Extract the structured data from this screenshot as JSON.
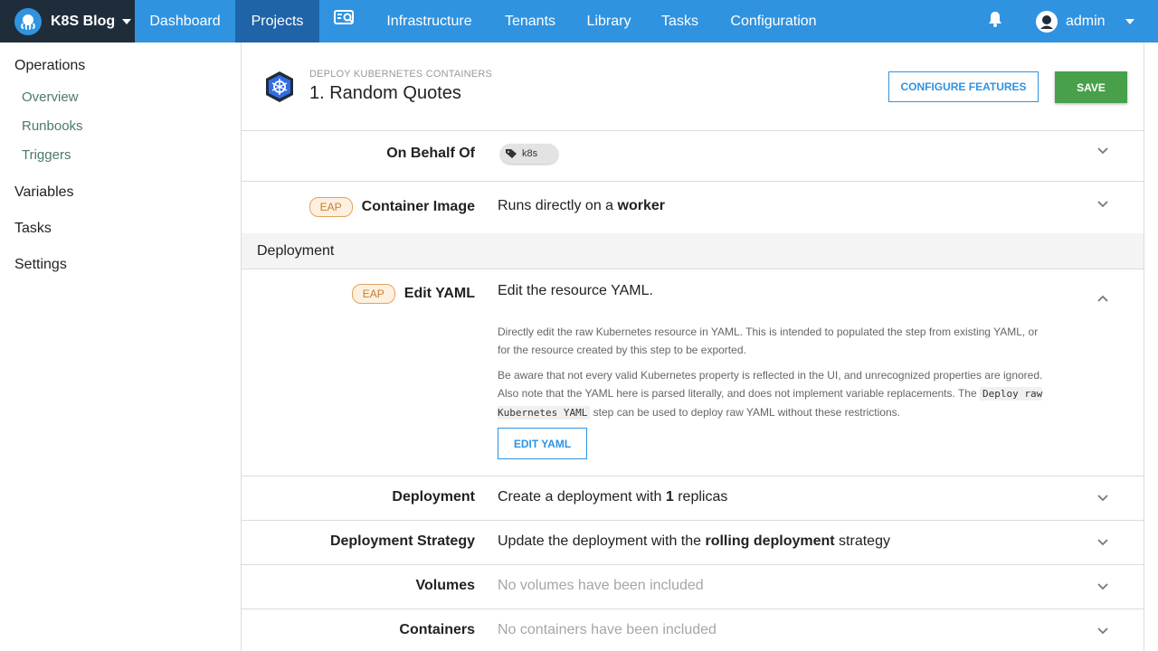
{
  "topbar": {
    "brand": "K8S Blog",
    "nav": [
      {
        "label": "Dashboard"
      },
      {
        "label": "Projects"
      },
      {
        "label": "Infrastructure"
      },
      {
        "label": "Tenants"
      },
      {
        "label": "Library"
      },
      {
        "label": "Tasks"
      },
      {
        "label": "Configuration"
      }
    ],
    "user": "admin",
    "active_nav": "Projects"
  },
  "sidebar": {
    "operations": "Operations",
    "operations_items": [
      "Overview",
      "Runbooks",
      "Triggers"
    ],
    "variables": "Variables",
    "tasks": "Tasks",
    "settings": "Settings"
  },
  "header": {
    "subtitle": "DEPLOY KUBERNETES CONTAINERS",
    "title": "1.  Random Quotes",
    "configure_label": "CONFIGURE FEATURES",
    "save_label": "SAVE"
  },
  "rows": {
    "on_behalf_of": {
      "label": "On Behalf Of",
      "tag": "k8s"
    },
    "container_image": {
      "badge": "EAP",
      "label": "Container Image",
      "value_prefix": "Runs directly on a ",
      "value_bold": "worker"
    },
    "section": "Deployment",
    "edit_yaml": {
      "badge": "EAP",
      "label": "Edit YAML",
      "value": "Edit the resource YAML.",
      "help1": "Directly edit the raw Kubernetes resource in YAML. This is intended to populated the step from existing YAML, or for the resource created by this step to be exported.",
      "help2_a": "Be aware that not every valid Kubernetes property is reflected in the UI, and unrecognized properties are ignored. Also note that the YAML here is parsed literally, and does not implement variable replacements. The ",
      "help2_code": "Deploy raw Kubernetes YAML",
      "help2_b": " step can be used to deploy raw YAML without these restrictions.",
      "button": "EDIT YAML"
    },
    "deployment": {
      "label": "Deployment",
      "pre": "Create a deployment with ",
      "bold": "1",
      "post": " replicas"
    },
    "strategy": {
      "label": "Deployment Strategy",
      "pre": "Update the deployment with the ",
      "bold": "rolling deployment",
      "post": " strategy"
    },
    "volumes": {
      "label": "Volumes",
      "value": "No volumes have been included"
    },
    "containers": {
      "label": "Containers",
      "value": "No containers have been included"
    }
  },
  "colors": {
    "topbar": "#2f93e0",
    "brand_bg": "#1f2d3a",
    "active_nav": "#1f64a8",
    "save": "#48a04a",
    "eap": "#e0a45e"
  },
  "icons": [
    "octopus-logo-icon",
    "caret-down-icon",
    "infrastructure-search-icon",
    "bell-icon",
    "user-avatar-icon",
    "kubernetes-icon",
    "tag-icon",
    "chevron-down-icon",
    "chevron-up-icon"
  ]
}
